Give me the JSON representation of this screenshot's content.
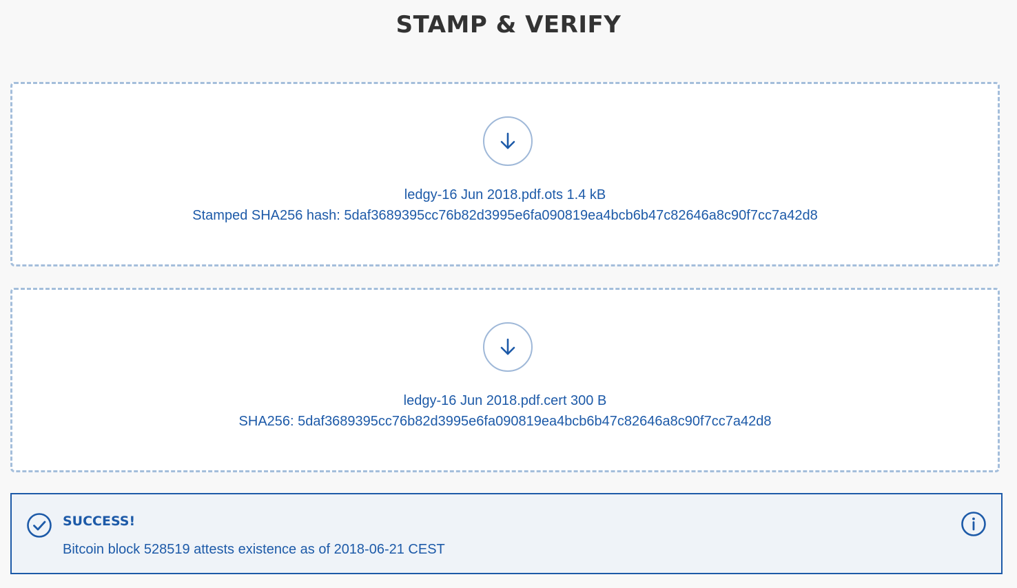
{
  "page": {
    "title": "STAMP & VERIFY"
  },
  "dropzones": [
    {
      "icon": "download-arrow-icon",
      "file_label": "ledgy-16 Jun 2018.pdf.ots 1.4 kB",
      "hash_label": "Stamped SHA256 hash: 5daf3689395cc76b82d3995e6fa090819ea4bcb6b47c82646a8c90f7cc7a42d8"
    },
    {
      "icon": "download-arrow-icon",
      "file_label": "ledgy-16 Jun 2018.pdf.cert 300 B",
      "hash_label": "SHA256: 5daf3689395cc76b82d3995e6fa090819ea4bcb6b47c82646a8c90f7cc7a42d8"
    }
  ],
  "result": {
    "status_icon": "check-circle-icon",
    "info_icon": "info-icon",
    "title": "SUCCESS!",
    "message": "Bitcoin block 528519 attests existence as of 2018-06-21 CEST"
  },
  "colors": {
    "accent": "#1d5aa8",
    "dash_border": "#a4bedb",
    "background": "#f8f8f8",
    "result_background": "#eff3f8",
    "title_text": "#333333"
  }
}
